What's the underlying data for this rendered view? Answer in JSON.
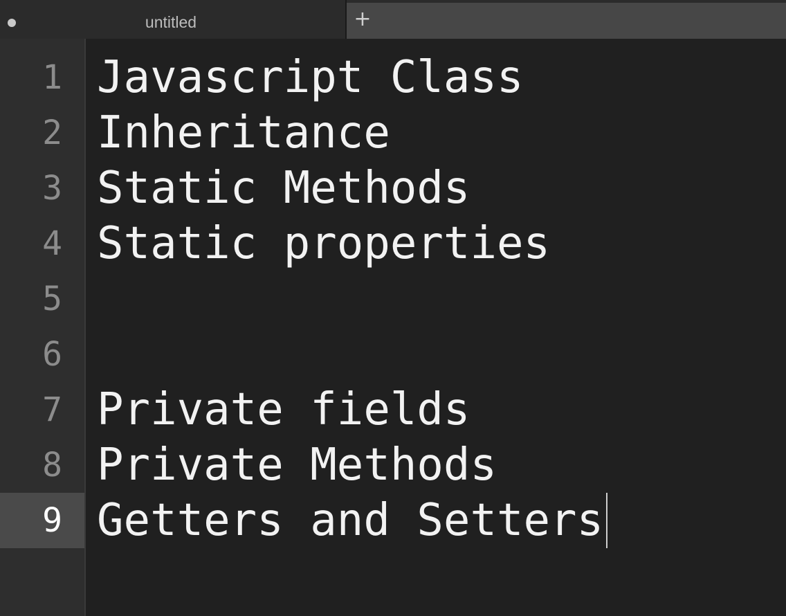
{
  "tab": {
    "title": "untitled",
    "modified_indicator": "dot-icon",
    "new_tab_label": "+"
  },
  "editor": {
    "lines": [
      {
        "number": "1",
        "text": "Javascript Class"
      },
      {
        "number": "2",
        "text": "Inheritance"
      },
      {
        "number": "3",
        "text": "Static Methods"
      },
      {
        "number": "4",
        "text": "Static properties"
      },
      {
        "number": "5",
        "text": ""
      },
      {
        "number": "6",
        "text": ""
      },
      {
        "number": "7",
        "text": "Private fields"
      },
      {
        "number": "8",
        "text": "Private Methods"
      },
      {
        "number": "9",
        "text": "Getters and Setters"
      }
    ],
    "active_line": 9
  },
  "colors": {
    "background": "#202020",
    "gutter": "#2e2e2e",
    "active_gutter": "#4a4a4a",
    "text": "#f2f2f2",
    "line_number": "#8c8c8c"
  }
}
